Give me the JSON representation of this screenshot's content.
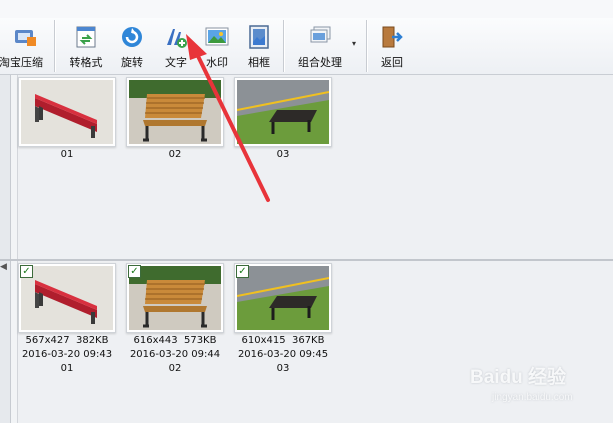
{
  "toolbar": {
    "buttons": [
      {
        "label": "淘宝压缩",
        "icon": "taobao-compress-icon"
      },
      {
        "label": "转格式",
        "icon": "convert-format-icon"
      },
      {
        "label": "旋转",
        "icon": "rotate-icon"
      },
      {
        "label": "文字",
        "icon": "add-text-icon"
      },
      {
        "label": "水印",
        "icon": "watermark-icon"
      },
      {
        "label": "相框",
        "icon": "photo-frame-icon"
      },
      {
        "label": "组合处理",
        "icon": "combine-process-icon"
      },
      {
        "label": "返回",
        "icon": "back-icon"
      }
    ],
    "dropdown_glyph": "▾"
  },
  "top_pane": {
    "items": [
      {
        "name": "01",
        "image": "red-bench"
      },
      {
        "name": "02",
        "image": "wooden-bench"
      },
      {
        "name": "03",
        "image": "black-bench-on-grass"
      }
    ]
  },
  "bottom_pane": {
    "items": [
      {
        "name": "01",
        "dims": "567x427",
        "size": "382KB",
        "datetime": "2016-03-20 09:43",
        "checked": true
      },
      {
        "name": "02",
        "dims": "616x443",
        "size": "573KB",
        "datetime": "2016-03-20 09:44",
        "checked": true
      },
      {
        "name": "03",
        "dims": "610x415",
        "size": "367KB",
        "datetime": "2016-03-20 09:45",
        "checked": true
      }
    ]
  },
  "watermark": {
    "text": "Baidu 经验",
    "url": "jingyan.baidu.com"
  },
  "colors": {
    "annotation_arrow": "#e8343a",
    "accent": "#3a7fd0"
  }
}
